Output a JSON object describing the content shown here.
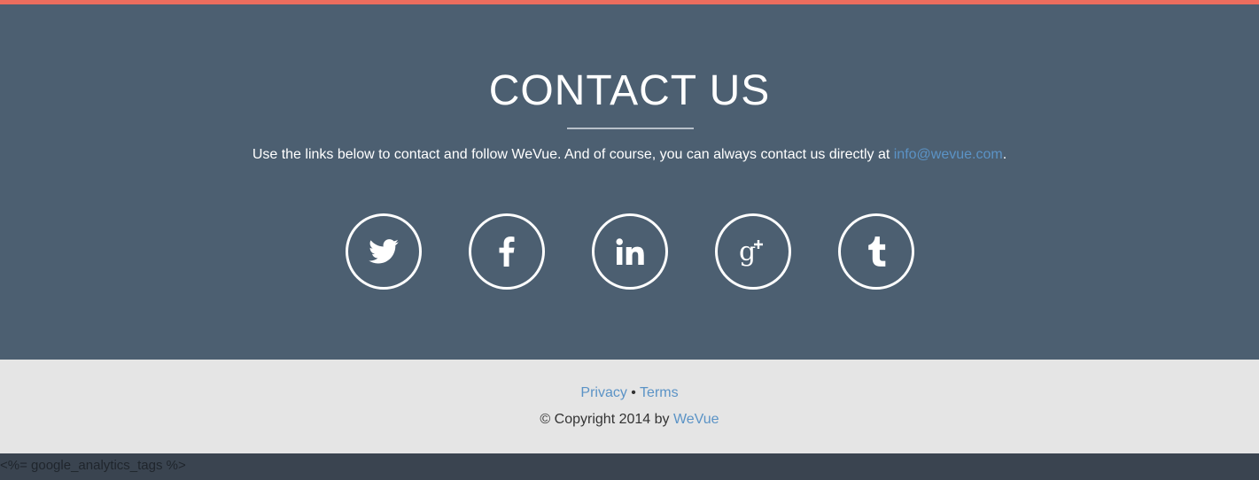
{
  "colors": {
    "accent_bar": "#ec6d5e",
    "contact_bg": "#4c5f71",
    "footer_bg": "#e5e5e5",
    "link": "#5b93c6",
    "bottom_bg": "#3a4450"
  },
  "contact": {
    "title": "CONTACT US",
    "text_before": "Use the links below to contact and follow WeVue. And of course, you can always contact us directly at ",
    "email": "info@wevue.com",
    "text_after": "."
  },
  "social": [
    {
      "name": "twitter",
      "icon": "twitter-icon"
    },
    {
      "name": "facebook",
      "icon": "facebook-icon"
    },
    {
      "name": "linkedin",
      "icon": "linkedin-icon"
    },
    {
      "name": "google-plus",
      "icon": "google-plus-icon"
    },
    {
      "name": "tumblr",
      "icon": "tumblr-icon"
    }
  ],
  "footer": {
    "privacy": "Privacy",
    "separator": " • ",
    "terms": "Terms",
    "copyright_prefix": "© Copyright 2014 by ",
    "brand": "WeVue"
  },
  "bottom": {
    "template_tag": "<%= google_analytics_tags %>"
  }
}
